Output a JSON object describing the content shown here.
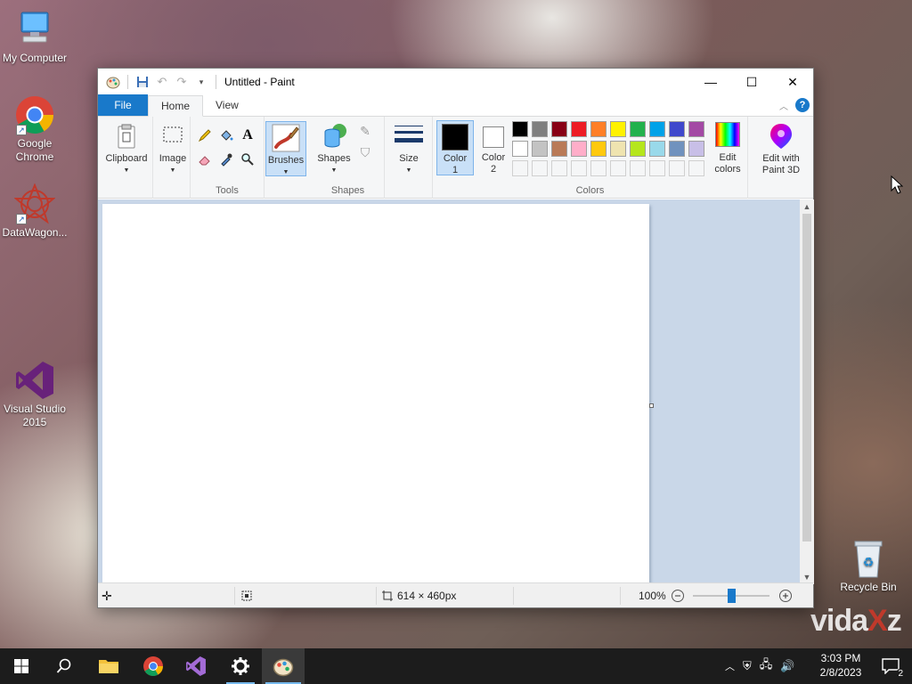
{
  "desktop": {
    "icons": [
      {
        "label": "My Computer"
      },
      {
        "label": "Google Chrome"
      },
      {
        "label": "DataWagon..."
      },
      {
        "label": "Visual Studio 2015"
      },
      {
        "label": "Recycle Bin"
      }
    ],
    "watermark": "vidaXz"
  },
  "window": {
    "title": "Untitled - Paint",
    "controls": {
      "minimize": "—",
      "maximize": "☐",
      "close": "✕"
    }
  },
  "tabs": [
    {
      "label": "File"
    },
    {
      "label": "Home"
    },
    {
      "label": "View"
    }
  ],
  "ribbon": {
    "clipboard": {
      "label": "Clipboard"
    },
    "image": {
      "label": "Image"
    },
    "tools": {
      "label": "Tools"
    },
    "brushes": {
      "label": "Brushes"
    },
    "shapes": {
      "button_label": "Shapes",
      "group_label": "Shapes"
    },
    "size": {
      "label": "Size"
    },
    "color1": {
      "label": "Color\n1",
      "line1": "Color",
      "line2": "1",
      "value": "#000000"
    },
    "color2": {
      "line1": "Color",
      "line2": "2",
      "value": "#ffffff"
    },
    "palette": [
      [
        "#000000",
        "#7f7f7f",
        "#880015",
        "#ed1c24",
        "#ff7f27",
        "#fff200",
        "#22b14c",
        "#00a2e8",
        "#3f48cc",
        "#a349a4"
      ],
      [
        "#ffffff",
        "#c3c3c3",
        "#b97a57",
        "#ffaec9",
        "#ffc90e",
        "#efe4b0",
        "#b5e61d",
        "#99d9ea",
        "#7092be",
        "#c8bfe7"
      ],
      [
        "#f5f6f7",
        "#f5f6f7",
        "#f5f6f7",
        "#f5f6f7",
        "#f5f6f7",
        "#f5f6f7",
        "#f5f6f7",
        "#f5f6f7",
        "#f5f6f7",
        "#f5f6f7"
      ]
    ],
    "colors_group_label": "Colors",
    "edit_colors": {
      "line1": "Edit",
      "line2": "colors"
    },
    "paint3d": {
      "line1": "Edit with",
      "line2": "Paint 3D"
    }
  },
  "status": {
    "dimensions": "614 × 460px",
    "zoom": "100%",
    "zoom_fraction": 0.5
  },
  "taskbar": {
    "time": "3:03 PM",
    "date": "2/8/2023",
    "notifications": "2"
  }
}
